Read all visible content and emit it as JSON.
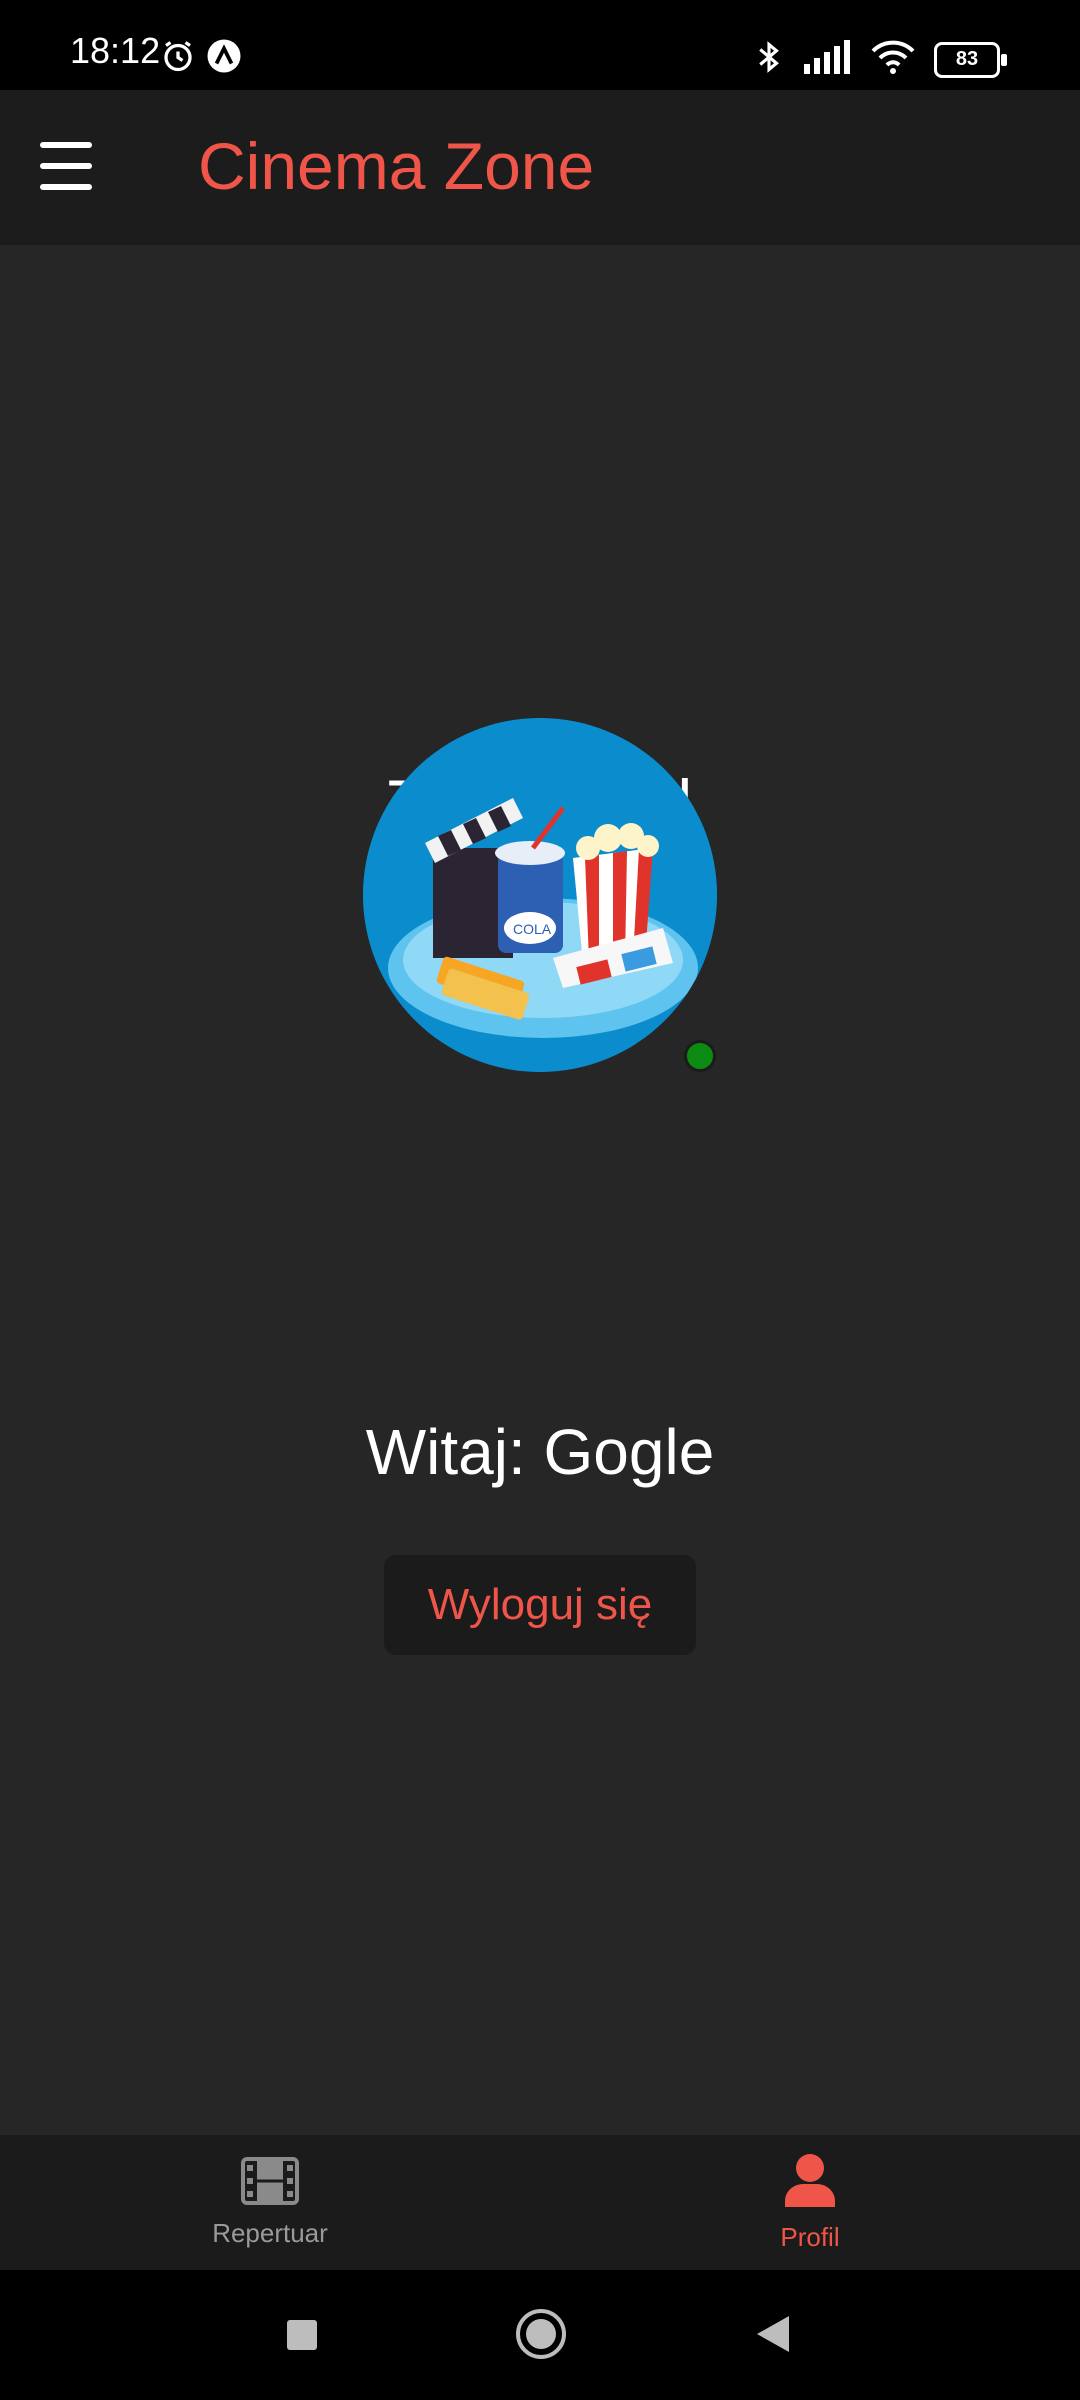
{
  "status_bar": {
    "time": "18:12",
    "battery": "83"
  },
  "app_bar": {
    "title": "Cinema Zone",
    "title_color": "#ef5548"
  },
  "profile": {
    "title": "Twój Profil",
    "welcome": "Witaj: Gogle",
    "logout_label": "Wyloguj się",
    "online_status_color": "#0d8a12",
    "avatar_icon": "cinema-snacks-illustration"
  },
  "bottom_nav": {
    "items": [
      {
        "label": "Repertuar",
        "icon": "film-icon",
        "active": false
      },
      {
        "label": "Profil",
        "icon": "person-icon",
        "active": true
      }
    ],
    "active_color": "#ef5548",
    "inactive_color": "#9a9a9a"
  },
  "system_nav": {
    "icons": [
      "recent-apps-icon",
      "home-icon",
      "back-icon"
    ]
  }
}
